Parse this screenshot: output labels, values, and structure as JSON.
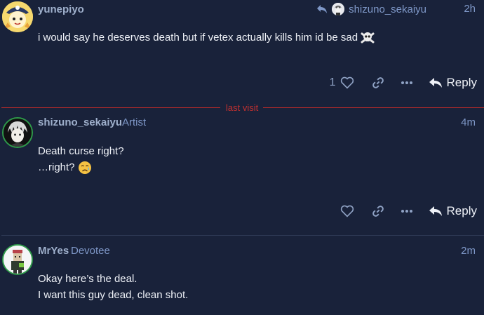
{
  "posts": [
    {
      "username": "yunepiyo",
      "user_title": "",
      "time": "2h",
      "reply_to_user": "shizuno_sekaiyu",
      "lines": [
        "i would say he deserves death but if vetex actually kills him id be sad"
      ],
      "like_count": "1",
      "reply_label": "Reply"
    },
    {
      "username": "shizuno_sekaiyu",
      "user_title": "Artist",
      "time": "4m",
      "lines": [
        "Death curse right?",
        "…right?"
      ],
      "reply_label": "Reply"
    },
    {
      "username": "MrYes",
      "user_title": "Devotee",
      "time": "2m",
      "lines": [
        "Okay here’s the deal.",
        "I want this guy dead, clean shot."
      ]
    }
  ],
  "last_visit_label": "last visit",
  "icons": {
    "reply_to": "reply-arrow-icon",
    "like": "heart-icon",
    "link": "link-icon",
    "more": "ellipsis-icon",
    "reply": "reply-icon",
    "skull": "skull-crossbones-emoji",
    "crying": "crying-face-emoji"
  },
  "colors": {
    "background": "#19223a",
    "accent": "#7f98c8",
    "last_visit": "#c03030",
    "avatar_ring": "#2f9a4a"
  }
}
